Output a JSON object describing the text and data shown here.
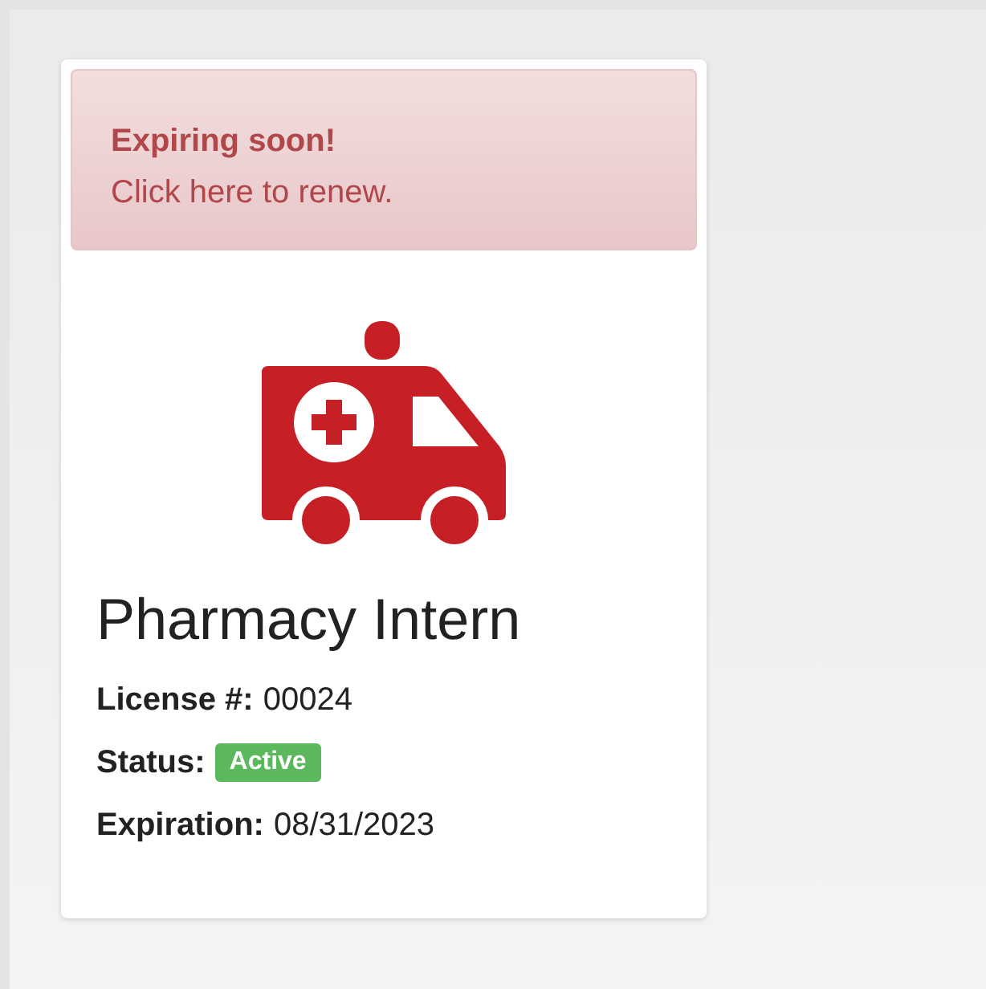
{
  "alert": {
    "title": "Expiring soon!",
    "text": "Click here to renew."
  },
  "license": {
    "title": "Pharmacy Intern",
    "fields": [
      {
        "kind": "text",
        "label": "License #:",
        "value": "00024"
      },
      {
        "kind": "badge",
        "label": "Status:",
        "value": "Active"
      },
      {
        "kind": "text",
        "label": "Expiration:",
        "value": "08/31/2023"
      }
    ]
  }
}
